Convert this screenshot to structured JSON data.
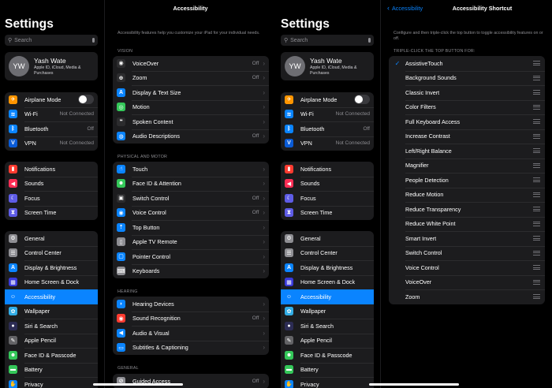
{
  "colors": {
    "accent": "#0a84ff",
    "row_bg": "#1c1c1e",
    "secondary_text": "#8e8e93"
  },
  "sidebar": {
    "title": "Settings",
    "search_placeholder": "Search",
    "profile": {
      "initials": "YW",
      "name": "Yash Wate",
      "subtitle": "Apple ID, iCloud, Media & Purchases"
    },
    "connectivity": [
      {
        "label": "Airplane Mode",
        "icon": "airplane-icon",
        "color": "#ff9500",
        "glyph": "✈",
        "value": "",
        "toggle": true
      },
      {
        "label": "Wi-Fi",
        "icon": "wifi-icon",
        "color": "#0a84ff",
        "glyph": "≋",
        "value": "Not Connected"
      },
      {
        "label": "Bluetooth",
        "icon": "bluetooth-icon",
        "color": "#0a84ff",
        "glyph": "ᛒ",
        "value": "Off"
      },
      {
        "label": "VPN",
        "icon": "vpn-icon",
        "color": "#0a5bd6",
        "glyph": "V",
        "value": "Not Connected"
      }
    ],
    "notifications_group": [
      {
        "label": "Notifications",
        "icon": "bell-icon",
        "color": "#ff3b30",
        "glyph": "▮"
      },
      {
        "label": "Sounds",
        "icon": "speaker-icon",
        "color": "#ff2d55",
        "glyph": "◀"
      },
      {
        "label": "Focus",
        "icon": "moon-icon",
        "color": "#5e5ce6",
        "glyph": "☾"
      },
      {
        "label": "Screen Time",
        "icon": "hourglass-icon",
        "color": "#5e5ce6",
        "glyph": "⧗"
      }
    ],
    "general_group": [
      {
        "label": "General",
        "icon": "gear-icon",
        "color": "#8e8e93",
        "glyph": "⚙"
      },
      {
        "label": "Control Center",
        "icon": "switches-icon",
        "color": "#8e8e93",
        "glyph": "☰"
      },
      {
        "label": "Display & Brightness",
        "icon": "brightness-icon",
        "color": "#0a84ff",
        "glyph": "A"
      },
      {
        "label": "Home Screen & Dock",
        "icon": "grid-icon",
        "color": "#3a3ad9",
        "glyph": "▦"
      },
      {
        "label": "Accessibility",
        "icon": "accessibility-icon",
        "color": "#0a84ff",
        "glyph": "☺",
        "active": true
      },
      {
        "label": "Wallpaper",
        "icon": "flower-icon",
        "color": "#32ade6",
        "glyph": "✿"
      },
      {
        "label": "Siri & Search",
        "icon": "siri-icon",
        "color": "#2c2c54",
        "glyph": "●"
      },
      {
        "label": "Apple Pencil",
        "icon": "pencil-icon",
        "color": "#636366",
        "glyph": "✎"
      },
      {
        "label": "Face ID & Passcode",
        "icon": "faceid-icon",
        "color": "#34c759",
        "glyph": "☻"
      },
      {
        "label": "Battery",
        "icon": "battery-icon",
        "color": "#34c759",
        "glyph": "▬"
      },
      {
        "label": "Privacy",
        "icon": "hand-icon",
        "color": "#0a84ff",
        "glyph": "✋"
      }
    ]
  },
  "accessibility": {
    "title": "Accessibility",
    "description": "Accessibility features help you customize your iPad for your individual needs.",
    "vision_label": "VISION",
    "vision": [
      {
        "label": "VoiceOver",
        "icon": "voiceover-icon",
        "color": "#2c2c2e",
        "glyph": "◉",
        "value": "Off"
      },
      {
        "label": "Zoom",
        "icon": "zoom-icon",
        "color": "#2c2c2e",
        "glyph": "⊕",
        "value": "Off"
      },
      {
        "label": "Display & Text Size",
        "icon": "text-size-icon",
        "color": "#0a84ff",
        "glyph": "A",
        "value": ""
      },
      {
        "label": "Motion",
        "icon": "motion-icon",
        "color": "#34c759",
        "glyph": "◎",
        "value": ""
      },
      {
        "label": "Spoken Content",
        "icon": "speech-bubble-icon",
        "color": "#2c2c2e",
        "glyph": "❝",
        "value": ""
      },
      {
        "label": "Audio Descriptions",
        "icon": "audio-description-icon",
        "color": "#0a84ff",
        "glyph": "◍",
        "value": "Off"
      }
    ],
    "physical_label": "PHYSICAL AND MOTOR",
    "physical": [
      {
        "label": "Touch",
        "icon": "touch-icon",
        "color": "#0a84ff",
        "glyph": "☝",
        "value": ""
      },
      {
        "label": "Face ID & Attention",
        "icon": "faceid-attention-icon",
        "color": "#34c759",
        "glyph": "☻",
        "value": ""
      },
      {
        "label": "Switch Control",
        "icon": "switch-control-icon",
        "color": "#2c2c2e",
        "glyph": "▣",
        "value": "Off"
      },
      {
        "label": "Voice Control",
        "icon": "voice-control-icon",
        "color": "#0a84ff",
        "glyph": "◉",
        "value": "Off"
      },
      {
        "label": "Top Button",
        "icon": "top-button-icon",
        "color": "#0a84ff",
        "glyph": "⇡",
        "value": ""
      },
      {
        "label": "Apple TV Remote",
        "icon": "remote-icon",
        "color": "#8e8e93",
        "glyph": "▯",
        "value": ""
      },
      {
        "label": "Pointer Control",
        "icon": "pointer-icon",
        "color": "#0a84ff",
        "glyph": "▢",
        "value": ""
      },
      {
        "label": "Keyboards",
        "icon": "keyboard-icon",
        "color": "#8e8e93",
        "glyph": "⌨",
        "value": ""
      }
    ],
    "hearing_label": "HEARING",
    "hearing": [
      {
        "label": "Hearing Devices",
        "icon": "ear-icon",
        "color": "#0a84ff",
        "glyph": "◗",
        "value": ""
      },
      {
        "label": "Sound Recognition",
        "icon": "sound-recognition-icon",
        "color": "#ff3b30",
        "glyph": "◉",
        "value": "Off"
      },
      {
        "label": "Audio & Visual",
        "icon": "audio-visual-icon",
        "color": "#0a84ff",
        "glyph": "◀",
        "value": ""
      },
      {
        "label": "Subtitles & Captioning",
        "icon": "captions-icon",
        "color": "#0a84ff",
        "glyph": "▭",
        "value": ""
      }
    ],
    "general_label": "GENERAL",
    "general": [
      {
        "label": "Guided Access",
        "icon": "guided-access-icon",
        "color": "#8e8e93",
        "glyph": "⊘",
        "value": "Off"
      }
    ]
  },
  "shortcut": {
    "back_label": "Accessibility",
    "title": "Accessibility Shortcut",
    "description": "Configure and then triple-click the top button to toggle accessibility features on or off.",
    "section_label": "TRIPLE-CLICK THE TOP BUTTON FOR:",
    "items": [
      {
        "label": "AssistiveTouch",
        "checked": true
      },
      {
        "label": "Background Sounds"
      },
      {
        "label": "Classic Invert"
      },
      {
        "label": "Color Filters"
      },
      {
        "label": "Full Keyboard Access"
      },
      {
        "label": "Increase Contrast"
      },
      {
        "label": "Left/Right Balance"
      },
      {
        "label": "Magnifier"
      },
      {
        "label": "People Detection"
      },
      {
        "label": "Reduce Motion"
      },
      {
        "label": "Reduce Transparency"
      },
      {
        "label": "Reduce White Point"
      },
      {
        "label": "Smart Invert"
      },
      {
        "label": "Switch Control"
      },
      {
        "label": "Voice Control"
      },
      {
        "label": "VoiceOver"
      },
      {
        "label": "Zoom"
      }
    ]
  }
}
